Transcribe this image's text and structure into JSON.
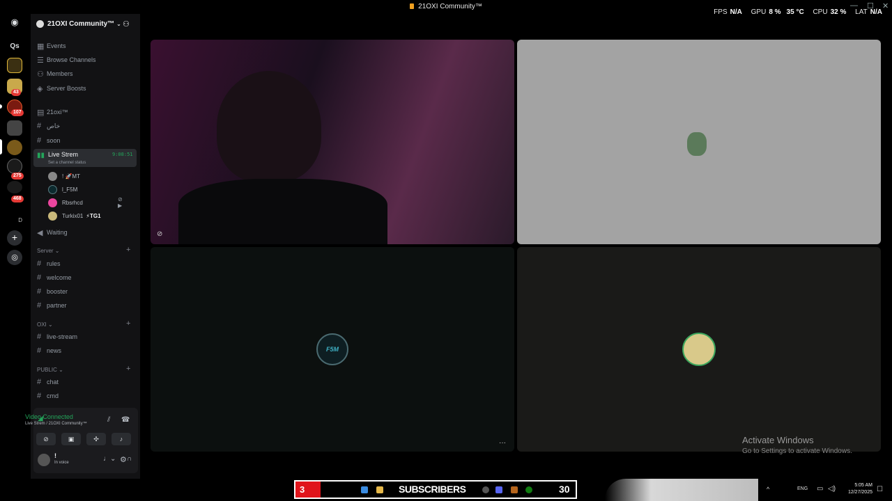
{
  "window": {
    "title": "21OXI Community™"
  },
  "overlay": {
    "fps_label": "FPS",
    "fps": "N/A",
    "gpu_label": "GPU",
    "gpu": "8 %",
    "gpu_temp": "35 °C",
    "cpu_label": "CPU",
    "cpu": "32 %",
    "lat_label": "LAT",
    "lat": "N/A"
  },
  "rail": {
    "dm_icon": "discord-logo-icon",
    "qs": "Qs",
    "badges": [
      "43",
      "107",
      "275",
      "468"
    ],
    "d_label": "D"
  },
  "server": {
    "name": "21OXI Community™"
  },
  "quick_links": [
    "Events",
    "Browse Channels",
    "Members",
    "Server Boosts"
  ],
  "channels_top": [
    "21oxi™",
    "خاص",
    "soon"
  ],
  "voice_channel": {
    "name": "Live Strem",
    "timer": "9:08:51",
    "status_hint": "Set a channel status"
  },
  "voice_users": [
    {
      "name": "! 🚀MT"
    },
    {
      "name": "l_F5M"
    },
    {
      "name": "Rbsrhcd"
    },
    {
      "name": "Turkix01",
      "tag": "⚡TG1"
    }
  ],
  "waiting": "Waiting",
  "categories": [
    {
      "name": "Server",
      "channels": [
        "rules",
        "welcome",
        "booster",
        "partner"
      ]
    },
    {
      "name": "OXI",
      "channels": [
        "live-stream",
        "news"
      ]
    },
    {
      "name": "PUBLIC",
      "channels": [
        "chat",
        "cmd"
      ]
    }
  ],
  "voice_panel": {
    "status": "Video Connected",
    "location": "Live Strem / 21OXI Community™"
  },
  "user_panel": {
    "name": "!",
    "status": "In voice"
  },
  "tiles": {
    "tile3_avatar": "F5M",
    "more": "···"
  },
  "watermark": {
    "title": "Activate Windows",
    "subtitle": "Go to Settings to activate Windows."
  },
  "taskbar": {
    "sub_count_left": "3",
    "subscribers": "SUBSCRIBERS",
    "sub_count_right": "30",
    "lang": "ENG",
    "time": "5:05 AM",
    "date": "12/27/2025"
  },
  "colors": {
    "accent_green": "#23a55a",
    "sidebar_bg": "#121214",
    "tile_gray": "#a3a3a3",
    "tile_dark": "#0c100f",
    "sub_red": "#e0141b"
  }
}
